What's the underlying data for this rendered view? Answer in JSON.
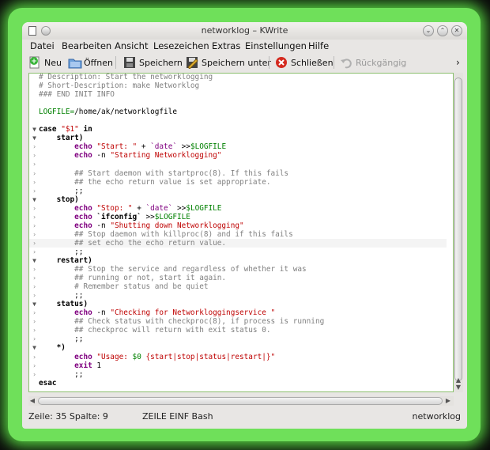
{
  "window": {
    "title": "networklog – KWrite"
  },
  "menu": {
    "items": [
      {
        "label": "Datei"
      },
      {
        "label": "Bearbeiten"
      },
      {
        "label": "Ansicht"
      },
      {
        "label": "Lesezeichen"
      },
      {
        "label": "Extras"
      },
      {
        "label": "Einstellungen"
      },
      {
        "label": "Hilfe"
      }
    ]
  },
  "toolbar": {
    "new_label": "Neu",
    "open_label": "Öffnen",
    "save_label": "Speichern",
    "saveas_label": "Speichern unter",
    "close_label": "Schließen",
    "undo_label": "Rückgängig",
    "overflow_icon": "chevron-right-icon"
  },
  "editor": {
    "lines": [
      {
        "fold": "",
        "segs": [
          [
            "c-comment",
            "# Description: Start the networklogging"
          ]
        ]
      },
      {
        "fold": "",
        "segs": [
          [
            "c-comment",
            "# Short-Description: make Networklog"
          ]
        ]
      },
      {
        "fold": "",
        "segs": [
          [
            "c-comment",
            "### END INIT INFO"
          ]
        ]
      },
      {
        "fold": "",
        "segs": []
      },
      {
        "fold": "",
        "segs": [
          [
            "c-var",
            "LOGFILE="
          ],
          [
            "c-plain",
            "/home/ak/networklogfile"
          ]
        ]
      },
      {
        "fold": "",
        "segs": []
      },
      {
        "fold": "tri",
        "segs": [
          [
            "c-kw",
            "case "
          ],
          [
            "c-str",
            "\"$1\""
          ],
          [
            "c-kw",
            " in"
          ]
        ]
      },
      {
        "fold": "tri",
        "segs": [
          [
            "c-kw",
            "    start)"
          ]
        ]
      },
      {
        "fold": "bar",
        "segs": [
          [
            "c-plain",
            "        "
          ],
          [
            "c-builtin",
            "echo"
          ],
          [
            "c-str",
            " \"Start: \""
          ],
          [
            "c-plain",
            " + "
          ],
          [
            "c-bt",
            "`date`"
          ],
          [
            "c-plain",
            " >>"
          ],
          [
            "c-var",
            "$LOGFILE"
          ]
        ]
      },
      {
        "fold": "bar",
        "segs": [
          [
            "c-plain",
            "        "
          ],
          [
            "c-builtin",
            "echo"
          ],
          [
            "c-plain",
            " -n "
          ],
          [
            "c-str",
            "\"Starting Networklogging\""
          ]
        ]
      },
      {
        "fold": "bar",
        "segs": []
      },
      {
        "fold": "bar",
        "segs": [
          [
            "c-comment",
            "        ## Start daemon with startproc(8). If this fails"
          ]
        ]
      },
      {
        "fold": "bar",
        "segs": [
          [
            "c-comment",
            "        ## the echo return value is set appropriate."
          ]
        ]
      },
      {
        "fold": "bar",
        "segs": [
          [
            "c-plain",
            "        ;;"
          ]
        ]
      },
      {
        "fold": "tri",
        "segs": [
          [
            "c-kw",
            "    stop)"
          ]
        ]
      },
      {
        "fold": "bar",
        "segs": [
          [
            "c-plain",
            "        "
          ],
          [
            "c-builtin",
            "echo"
          ],
          [
            "c-str",
            " \"Stop: \""
          ],
          [
            "c-plain",
            " + "
          ],
          [
            "c-bt",
            "`date`"
          ],
          [
            "c-plain",
            " >>"
          ],
          [
            "c-var",
            "$LOGFILE"
          ]
        ]
      },
      {
        "fold": "bar",
        "segs": [
          [
            "c-plain",
            "        "
          ],
          [
            "c-builtin",
            "echo"
          ],
          [
            "c-plain",
            " "
          ],
          [
            "c-kw",
            "`ifconfig`"
          ],
          [
            "c-plain",
            " >>"
          ],
          [
            "c-var",
            "$LOGFILE"
          ]
        ]
      },
      {
        "fold": "bar",
        "segs": [
          [
            "c-plain",
            "        "
          ],
          [
            "c-builtin",
            "echo"
          ],
          [
            "c-plain",
            " -n "
          ],
          [
            "c-str",
            "\"Shutting down Networklogging\""
          ]
        ]
      },
      {
        "fold": "bar",
        "segs": [
          [
            "c-comment",
            "        ## Stop daemon with killproc(8) and if this fails"
          ]
        ]
      },
      {
        "fold": "bar",
        "hl": true,
        "segs": [
          [
            "c-comment",
            "        ## set echo the echo return value."
          ]
        ]
      },
      {
        "fold": "bar",
        "segs": [
          [
            "c-plain",
            "        ;;"
          ]
        ]
      },
      {
        "fold": "tri",
        "segs": [
          [
            "c-kw",
            "    restart)"
          ]
        ]
      },
      {
        "fold": "bar",
        "segs": [
          [
            "c-comment",
            "        ## Stop the service and regardless of whether it was"
          ]
        ]
      },
      {
        "fold": "bar",
        "segs": [
          [
            "c-comment",
            "        ## running or not, start it again."
          ]
        ]
      },
      {
        "fold": "bar",
        "segs": [
          [
            "c-comment",
            "        # Remember status and be quiet"
          ]
        ]
      },
      {
        "fold": "bar",
        "segs": [
          [
            "c-plain",
            "        ;;"
          ]
        ]
      },
      {
        "fold": "tri",
        "segs": [
          [
            "c-kw",
            "    status)"
          ]
        ]
      },
      {
        "fold": "bar",
        "segs": [
          [
            "c-plain",
            "        "
          ],
          [
            "c-builtin",
            "echo"
          ],
          [
            "c-plain",
            " -n "
          ],
          [
            "c-str",
            "\"Checking for Networkloggingservice \""
          ]
        ]
      },
      {
        "fold": "bar",
        "segs": [
          [
            "c-comment",
            "        ## Check status with checkproc(8), if process is running"
          ]
        ]
      },
      {
        "fold": "bar",
        "segs": [
          [
            "c-comment",
            "        ## checkproc will return with exit status 0."
          ]
        ]
      },
      {
        "fold": "bar",
        "segs": [
          [
            "c-plain",
            "        ;;"
          ]
        ]
      },
      {
        "fold": "tri",
        "segs": [
          [
            "c-kw",
            "    *)"
          ]
        ]
      },
      {
        "fold": "bar",
        "segs": [
          [
            "c-plain",
            "        "
          ],
          [
            "c-builtin",
            "echo"
          ],
          [
            "c-str",
            " \"Usage: "
          ],
          [
            "c-var",
            "$0"
          ],
          [
            "c-str",
            " {start|stop|status|restart|}\""
          ]
        ]
      },
      {
        "fold": "bar",
        "segs": [
          [
            "c-plain",
            "        "
          ],
          [
            "c-builtin",
            "exit"
          ],
          [
            "c-plain",
            " 1"
          ]
        ]
      },
      {
        "fold": "bar",
        "segs": [
          [
            "c-plain",
            "        ;;"
          ]
        ]
      },
      {
        "fold": "",
        "segs": [
          [
            "c-kw",
            "esac"
          ]
        ]
      }
    ]
  },
  "status": {
    "position": "Zeile: 35 Spalte: 9",
    "mode": "ZEILE  EINF  Bash",
    "filename": "networklog"
  },
  "colors": {
    "accent_glow": "#6fe05a",
    "comment": "#808080",
    "variable": "#008000",
    "string": "#bf0303",
    "builtin": "#800080"
  }
}
